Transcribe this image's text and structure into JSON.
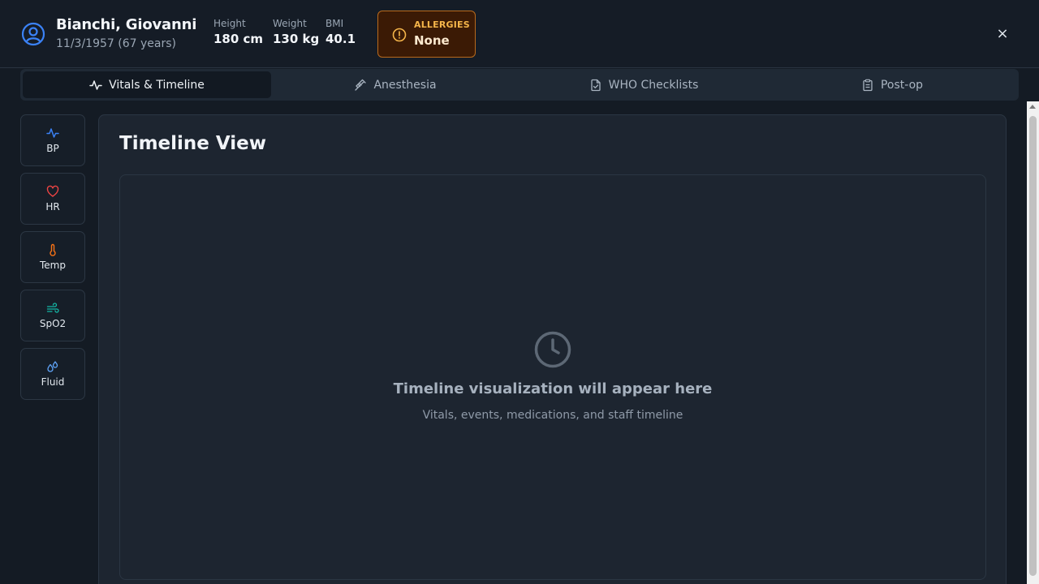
{
  "window": {
    "close_glyph": "×"
  },
  "patient": {
    "name": "Bianchi, Giovanni",
    "dob": "11/3/1957 (67 years)",
    "avatar_icon": "user-circle-icon"
  },
  "metrics": [
    {
      "label": "Height",
      "value": "180 cm"
    },
    {
      "label": "Weight",
      "value": "130 kg"
    },
    {
      "label": "BMI",
      "value": "40.1"
    }
  ],
  "allergies": {
    "label": "ALLERGIES",
    "value": "None",
    "icon": "alert-circle-icon"
  },
  "header_close": "×",
  "tabs": [
    {
      "label": "Vitals & Timeline",
      "icon": "activity-icon",
      "active": true
    },
    {
      "label": "Anesthesia",
      "icon": "syringe-icon",
      "active": false
    },
    {
      "label": "WHO Checklists",
      "icon": "file-check-icon",
      "active": false
    },
    {
      "label": "Post-op",
      "icon": "clipboard-icon",
      "active": false
    }
  ],
  "sidebar": [
    {
      "label": "BP",
      "icon": "activity-icon",
      "color": "#3b82f6"
    },
    {
      "label": "HR",
      "icon": "heart-icon",
      "color": "#ef4444"
    },
    {
      "label": "Temp",
      "icon": "thermometer-icon",
      "color": "#f97316"
    },
    {
      "label": "SpO2",
      "icon": "wind-icon",
      "color": "#14b8a6"
    },
    {
      "label": "Fluid",
      "icon": "droplets-icon",
      "color": "#60a5fa"
    }
  ],
  "main": {
    "title": "Timeline View",
    "empty_title": "Timeline visualization will appear here",
    "empty_subtitle": "Vitals, events, medications, and staff timeline"
  },
  "colors": {
    "background": "#141b24",
    "accent": "#3b82f6",
    "allergy_bg": "#3b1a05",
    "allergy_border": "#b86a1d",
    "allergy_label": "#f5b54a"
  }
}
